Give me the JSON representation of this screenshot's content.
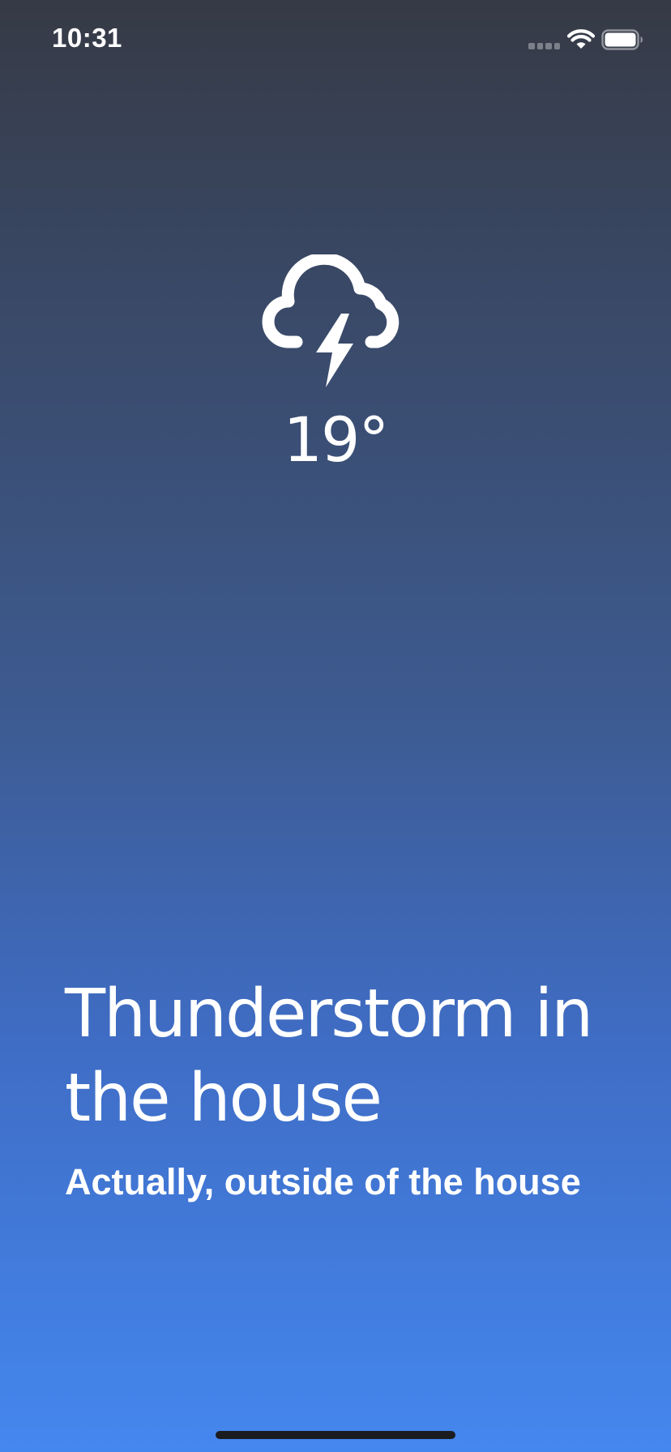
{
  "status_bar": {
    "time": "10:31",
    "signal_icon": "cellular-signal-icon",
    "wifi_icon": "wifi-icon",
    "battery_icon": "battery-icon"
  },
  "weather": {
    "icon": "thunderstorm-cloud-icon",
    "temperature": "19°",
    "headline": "Thunderstorm in the house",
    "subheadline": "Actually, outside of the house"
  },
  "colors": {
    "gradient_top": "#363a45",
    "gradient_bottom": "#4487ef",
    "text": "#ffffff",
    "home_indicator": "#1b1c20"
  }
}
